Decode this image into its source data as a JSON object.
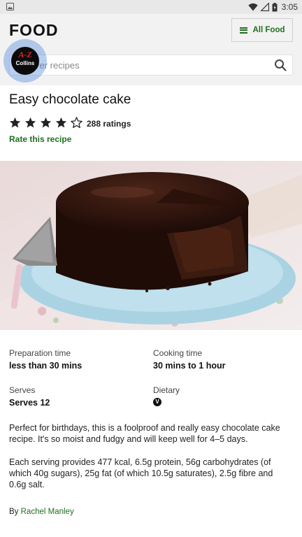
{
  "status_bar": {
    "time": "3:05"
  },
  "header": {
    "logo": "FOOD",
    "all_food_label": "All Food"
  },
  "search": {
    "placeholder": "Discover recipes",
    "visible_text": "ver recipes"
  },
  "overlay": {
    "az": "A-Z",
    "name": "Collins"
  },
  "recipe": {
    "title": "Easy chocolate cake",
    "rating": {
      "filled_stars": 4,
      "total_stars": 5,
      "count_label": "288 ratings"
    },
    "rate_label": "Rate this recipe",
    "prep_label": "Preparation time",
    "prep_value": "less than 30 mins",
    "cook_label": "Cooking time",
    "cook_value": "30 mins to 1 hour",
    "serves_label": "Serves",
    "serves_value": "Serves 12",
    "dietary_label": "Dietary",
    "dietary_badge": "V",
    "description": "Perfect for birthdays, this is a foolproof and really easy chocolate cake recipe. It's so moist and fudgy and will keep well for 4–5 days.",
    "nutrition": "Each serving provides 477 kcal, 6.5g protein, 56g carbohydrates (of which 40g sugars), 25g fat (of which 10.5g saturates), 2.5g fibre and 0.6g salt.",
    "by_label": "By",
    "author": "Rachel Manley"
  },
  "colors": {
    "brand_green": "#1f6f1f",
    "header_bg": "#f2f2f2"
  }
}
